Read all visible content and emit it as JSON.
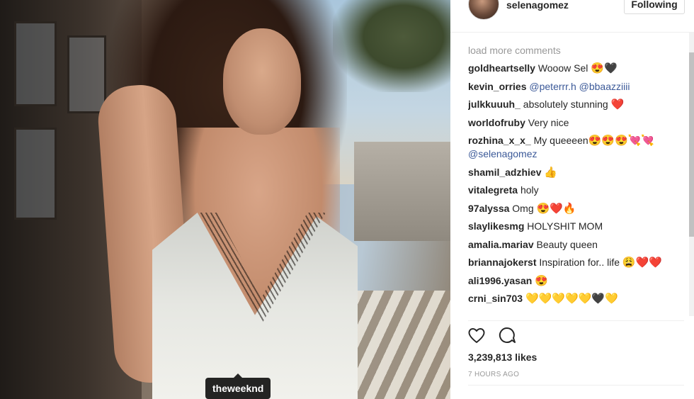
{
  "post": {
    "tag_label": "theweeknd"
  },
  "header": {
    "username": "selenagomez",
    "follow_label": "Following"
  },
  "comments": {
    "load_more": "load more comments",
    "items": [
      {
        "user": "goldheartselly",
        "text": "Wooow Sel",
        "emoji": "😍🖤"
      },
      {
        "user": "kevin_orries",
        "text": "",
        "mentions": "@peterrr.h @bbaazziiii",
        "emoji": ""
      },
      {
        "user": "julkkuuuh_",
        "text": "absolutely stunning",
        "emoji": "❤️"
      },
      {
        "user": "worldofruby",
        "text": "Very nice",
        "emoji": ""
      },
      {
        "user": "rozhina_x_x_",
        "text": "My queeeen",
        "emoji": "😍😍😍💘💘",
        "mention_after": "@selenagomez"
      },
      {
        "user": "shamil_adzhiev",
        "text": "",
        "emoji": "👍"
      },
      {
        "user": "vitalegreta",
        "text": "holy",
        "emoji": ""
      },
      {
        "user": "97alyssa",
        "text": "Omg",
        "emoji": "😍❤️🔥"
      },
      {
        "user": "slaylikesmg",
        "text": "HOLYSHIT MOM",
        "emoji": ""
      },
      {
        "user": "amalia.mariav",
        "text": "Beauty queen",
        "emoji": ""
      },
      {
        "user": "briannajokerst",
        "text": "Inspiration for.. life",
        "emoji": "😩❤️❤️"
      },
      {
        "user": "ali1996.yasan",
        "text": "",
        "emoji": "😍"
      },
      {
        "user": "crni_sin703",
        "text": "",
        "emoji": "💛💛💛💛💛🖤💛"
      }
    ]
  },
  "footer": {
    "likes": "3,239,813 likes",
    "time": "7 HOURS AGO"
  },
  "icons": {
    "like": "heart-icon",
    "comment": "comment-bubble-icon"
  }
}
